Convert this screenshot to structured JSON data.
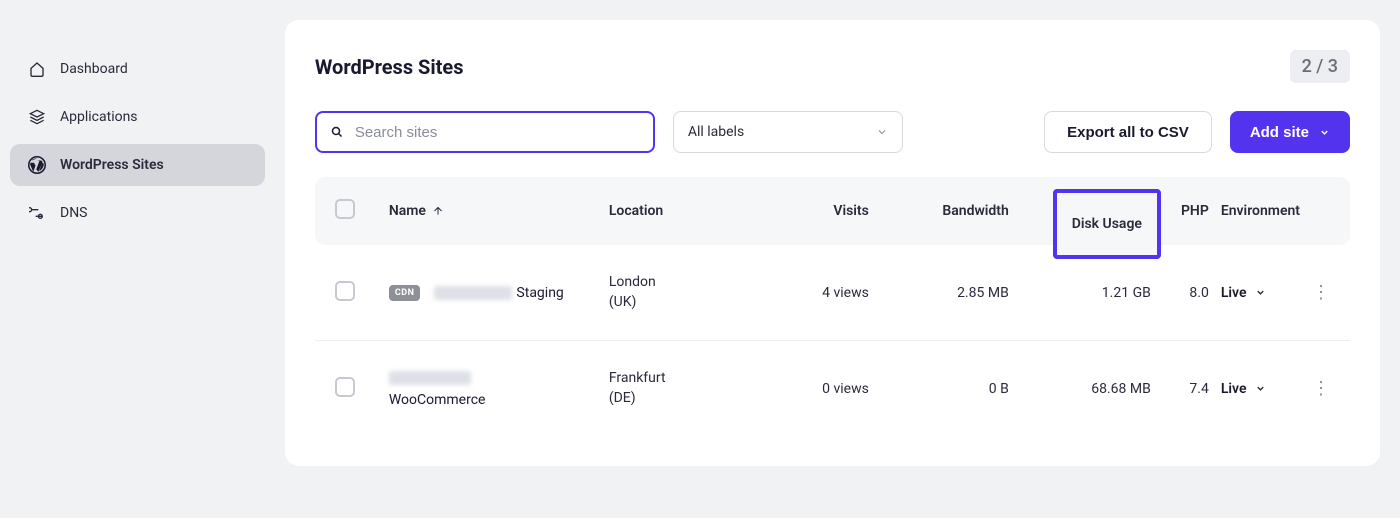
{
  "sidebar": {
    "items": [
      {
        "label": "Dashboard"
      },
      {
        "label": "Applications"
      },
      {
        "label": "WordPress Sites"
      },
      {
        "label": "DNS"
      }
    ]
  },
  "page": {
    "title": "WordPress Sites",
    "pagination": "2 / 3"
  },
  "controls": {
    "search_placeholder": "Search sites",
    "labels_select": "All labels",
    "export_label": "Export all to CSV",
    "add_site_label": "Add site"
  },
  "table": {
    "headers": {
      "name": "Name",
      "location": "Location",
      "visits": "Visits",
      "bandwidth": "Bandwidth",
      "disk_usage": "Disk Usage",
      "php": "PHP",
      "environment": "Environment"
    },
    "rows": [
      {
        "cdn": "CDN",
        "name_suffix": "Staging",
        "location_line1": "London",
        "location_line2": "(UK)",
        "visits": "4 views",
        "bandwidth": "2.85 MB",
        "disk_usage": "1.21 GB",
        "php": "8.0",
        "environment": "Live"
      },
      {
        "cdn": "",
        "name_suffix": "WooCommerce",
        "location_line1": "Frankfurt",
        "location_line2": "(DE)",
        "visits": "0 views",
        "bandwidth": "0 B",
        "disk_usage": "68.68 MB",
        "php": "7.4",
        "environment": "Live"
      }
    ]
  }
}
